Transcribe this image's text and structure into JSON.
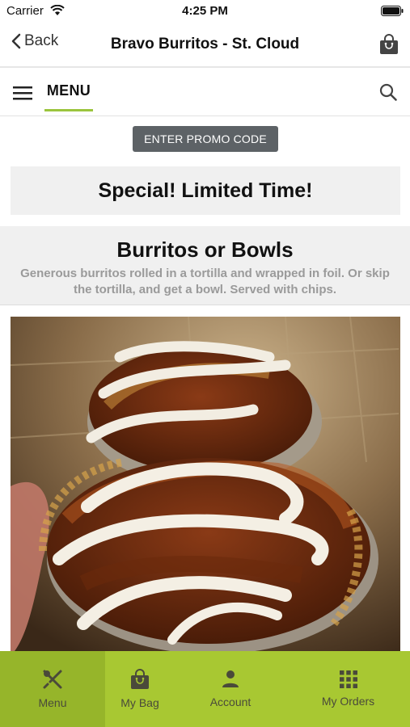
{
  "status_bar": {
    "carrier": "Carrier",
    "time": "4:25 PM"
  },
  "nav": {
    "back_label": "Back",
    "title": "Bravo Burritos - St. Cloud"
  },
  "menu_bar": {
    "tab_label": "MENU"
  },
  "promo": {
    "label": "ENTER PROMO CODE"
  },
  "special": {
    "title": "Special! Limited Time!"
  },
  "category": {
    "title": "Burritos or Bowls",
    "description": "Generous burritos rolled in a tortilla and wrapped in foil. Or skip the tortilla, and get a bowl. Served with chips."
  },
  "tab_bar": {
    "items": [
      {
        "label": "Menu",
        "icon": "utensils-icon",
        "active": true
      },
      {
        "label": "My Bag",
        "icon": "bag-icon",
        "active": false
      },
      {
        "label": "Account",
        "icon": "person-icon",
        "active": false
      },
      {
        "label": "My Orders",
        "icon": "grid-icon",
        "active": false
      }
    ]
  },
  "colors": {
    "accent": "#9bc53d",
    "tab_bar": "#a8c832",
    "promo_button": "#5d6266"
  }
}
